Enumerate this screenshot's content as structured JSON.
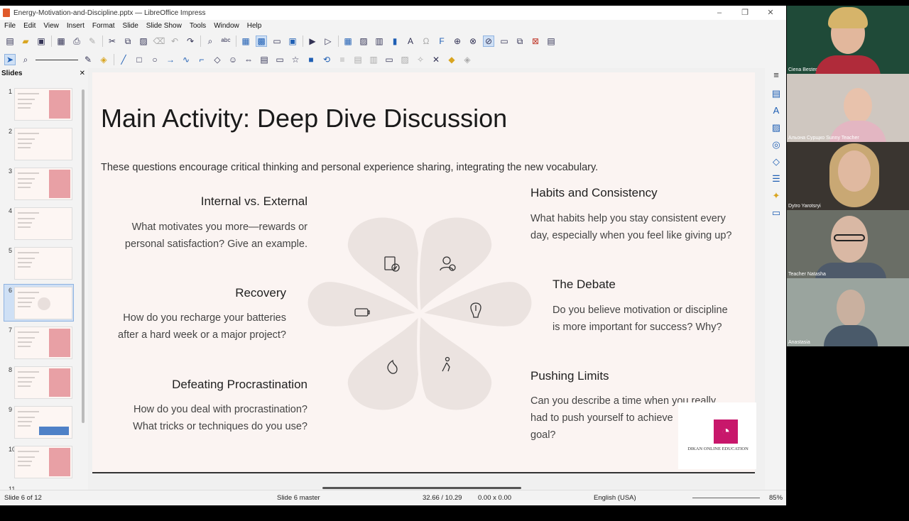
{
  "window": {
    "title": "Energy-Motivation-and-Discipline.pptx — LibreOffice Impress",
    "controls": [
      "–",
      "❐",
      "✕"
    ]
  },
  "menu": [
    "File",
    "Edit",
    "View",
    "Insert",
    "Format",
    "Slide",
    "Slide Show",
    "Tools",
    "Window",
    "Help"
  ],
  "slides_pane": {
    "title": "Slides",
    "close": "✕",
    "numbers": [
      "1",
      "2",
      "3",
      "4",
      "5",
      "6",
      "7",
      "8",
      "9",
      "10",
      "11"
    ],
    "active": "6"
  },
  "slide": {
    "title": "Main Activity: Deep Dive Discussion",
    "subtitle": "These questions encourage critical thinking and personal experience sharing, integrating the new vocabulary.",
    "questions": {
      "internal": {
        "title": "Internal vs. External",
        "line1": "What motivates you more—rewards or",
        "line2": "personal satisfaction? Give an example."
      },
      "recovery": {
        "title": "Recovery",
        "line1": "How do you recharge your batteries",
        "line2": "after a hard week or a major project?"
      },
      "procrastination": {
        "title": "Defeating Procrastination",
        "line1": "How do you deal with procrastination?",
        "line2": "What tricks or techniques do you use?"
      },
      "habits": {
        "title": "Habits and Consistency",
        "line1": "What habits help you stay consistent every",
        "line2": "day, especially when you feel like giving up?"
      },
      "debate": {
        "title": "The Debate",
        "line1": "Do you believe motivation or discipline",
        "line2": "is more important for success? Why?"
      },
      "limits": {
        "title": "Pushing Limits",
        "line1": "Can you describe a time when you really",
        "line2": "had to push yourself to achieve",
        "line3": "goal?"
      }
    },
    "logo": {
      "text": "DIKAN ONLINE EDUCATION"
    }
  },
  "status": {
    "slide_of": "Slide 6 of 12",
    "master": "Slide 6 master",
    "position": "32.66 / 10.29",
    "size": "0.00 x 0.00",
    "language": "English (USA)",
    "zoom": "85%"
  },
  "participants": [
    {
      "name": "Ciena Bester"
    },
    {
      "name": "Альона Сурщко Sunny Teacher"
    },
    {
      "name": "Dytro Yarotsryi"
    },
    {
      "name": "Teacher Natasha"
    },
    {
      "name": "Anastasia"
    }
  ]
}
